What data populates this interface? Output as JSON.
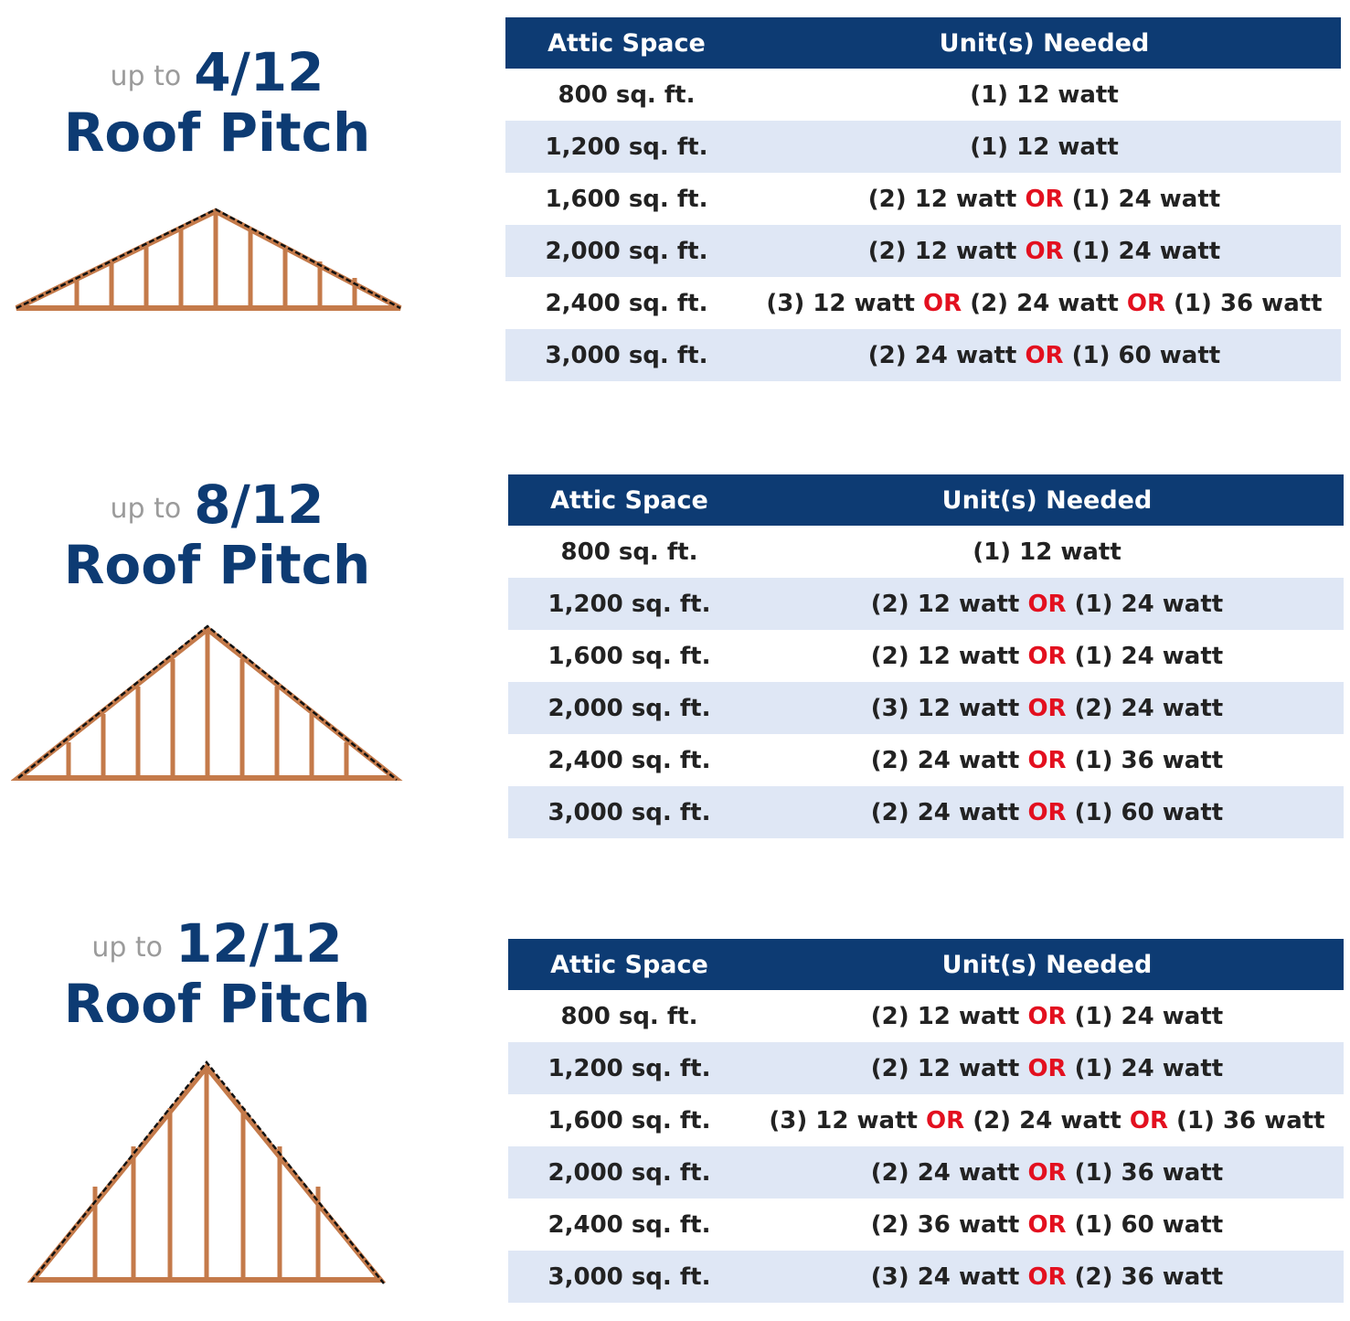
{
  "colors": {
    "navy": "#0d3b73",
    "or_red": "#e3101f",
    "wood": "#c47a4a",
    "stripe": "#dfe7f5",
    "muted": "#9b9b9b"
  },
  "connector": "OR",
  "sections": [
    {
      "prefix": "up to",
      "pitch": "4/12",
      "title": "Roof Pitch",
      "headers": {
        "space": "Attic Space",
        "units": "Unit(s) Needed"
      },
      "rows": [
        {
          "space": "800 sq. ft.",
          "options": [
            "(1) 12 watt"
          ]
        },
        {
          "space": "1,200 sq. ft.",
          "options": [
            "(1) 12 watt"
          ]
        },
        {
          "space": "1,600 sq. ft.",
          "options": [
            "(2) 12 watt",
            "(1) 24 watt"
          ]
        },
        {
          "space": "2,000 sq. ft.",
          "options": [
            "(2) 12 watt",
            "(1) 24 watt"
          ]
        },
        {
          "space": "2,400 sq. ft.",
          "options": [
            "(3) 12 watt",
            "(2) 24 watt",
            "(1) 36 watt"
          ]
        },
        {
          "space": "3,000 sq. ft.",
          "options": [
            "(2) 24 watt",
            "(1) 60 watt"
          ]
        }
      ]
    },
    {
      "prefix": "up to",
      "pitch": "8/12",
      "title": "Roof Pitch",
      "headers": {
        "space": "Attic Space",
        "units": "Unit(s) Needed"
      },
      "rows": [
        {
          "space": "800 sq. ft.",
          "options": [
            "(1) 12 watt"
          ]
        },
        {
          "space": "1,200 sq. ft.",
          "options": [
            "(2) 12 watt",
            "(1) 24 watt"
          ]
        },
        {
          "space": "1,600 sq. ft.",
          "options": [
            "(2) 12 watt",
            "(1) 24 watt"
          ]
        },
        {
          "space": "2,000 sq. ft.",
          "options": [
            "(3) 12 watt",
            "(2) 24 watt"
          ]
        },
        {
          "space": "2,400 sq. ft.",
          "options": [
            "(2) 24 watt",
            "(1) 36 watt"
          ]
        },
        {
          "space": "3,000 sq. ft.",
          "options": [
            "(2) 24 watt",
            "(1) 60 watt"
          ]
        }
      ]
    },
    {
      "prefix": "up to",
      "pitch": "12/12",
      "title": "Roof Pitch",
      "headers": {
        "space": "Attic Space",
        "units": "Unit(s) Needed"
      },
      "rows": [
        {
          "space": "800 sq. ft.",
          "options": [
            "(2) 12 watt",
            "(1) 24 watt"
          ]
        },
        {
          "space": "1,200 sq. ft.",
          "options": [
            "(2) 12 watt",
            "(1) 24 watt"
          ]
        },
        {
          "space": "1,600 sq. ft.",
          "options": [
            "(3) 12 watt",
            "(2) 24 watt",
            "(1) 36 watt"
          ]
        },
        {
          "space": "2,000 sq. ft.",
          "options": [
            "(2) 24 watt",
            "(1) 36 watt"
          ]
        },
        {
          "space": "2,400 sq. ft.",
          "options": [
            "(2) 36 watt",
            "(1) 60 watt"
          ]
        },
        {
          "space": "3,000 sq. ft.",
          "options": [
            "(3) 24 watt",
            "(2) 36 watt"
          ]
        }
      ]
    }
  ]
}
